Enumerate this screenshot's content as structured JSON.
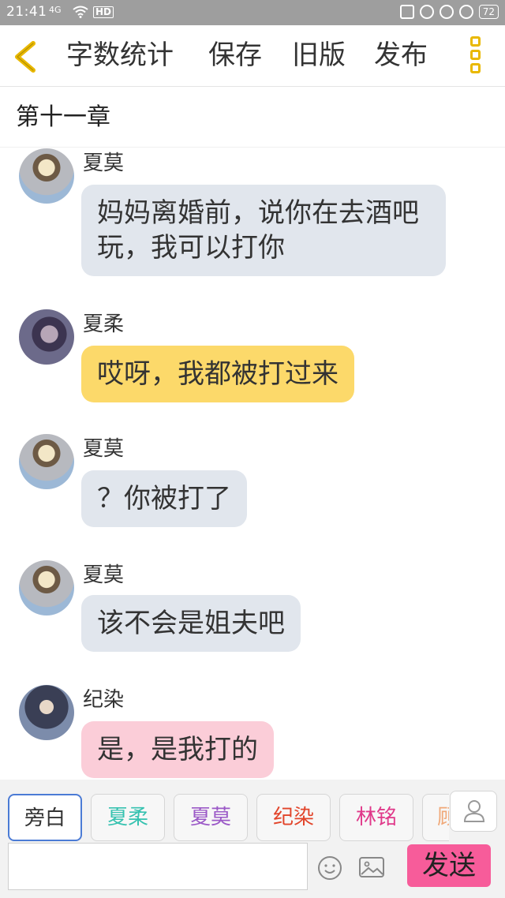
{
  "status_bar": {
    "time": "21:41",
    "signal_text": "4G",
    "hd_label": "HD",
    "battery": "72"
  },
  "toolbar": {
    "word_count_label": "字数统计",
    "save_label": "保存",
    "old_version_label": "旧版",
    "publish_label": "发布"
  },
  "chapter": {
    "title": "第十一章"
  },
  "messages": [
    {
      "name": "夏莫",
      "text": "妈妈离婚前，说你在去酒吧玩，我可以打你",
      "bubble_color": "#e1e6ed"
    },
    {
      "name": "夏柔",
      "text": "哎呀，我都被打过来",
      "bubble_color": "#fcd96a"
    },
    {
      "name": "夏莫",
      "text": "？你被打了",
      "bubble_color": "#e1e6ed"
    },
    {
      "name": "夏莫",
      "text": "该不会是姐夫吧",
      "bubble_color": "#e1e6ed"
    },
    {
      "name": "纪染",
      "text": "是，是我打的",
      "bubble_color": "#fbcdd8"
    }
  ],
  "roles": [
    {
      "label": "旁白",
      "color": "#333333"
    },
    {
      "label": "夏柔",
      "color": "#36c2b0"
    },
    {
      "label": "夏莫",
      "color": "#9b59c7"
    },
    {
      "label": "纪染",
      "color": "#e2452b"
    },
    {
      "label": "林铭",
      "color": "#e0398a"
    },
    {
      "label": "顾",
      "color": "#f0a878"
    }
  ],
  "input": {
    "placeholder": "",
    "send_label": "发送"
  },
  "colors": {
    "accent_yellow": "#e9b800",
    "send_pink": "#f75c9a"
  }
}
